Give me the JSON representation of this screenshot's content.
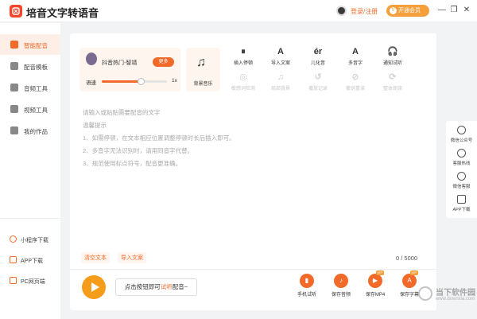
{
  "app": {
    "title": "培音文字转语音"
  },
  "header": {
    "login_label": "登录/注册",
    "vip_label": "开通会员",
    "vip_badge": "V",
    "minimize": "—",
    "maximize": "❐",
    "close": "✕"
  },
  "sidebar": {
    "items": [
      {
        "label": "智能配音",
        "active": true
      },
      {
        "label": "配音模板"
      },
      {
        "label": "音频工具"
      },
      {
        "label": "视频工具"
      },
      {
        "label": "我的作品"
      }
    ],
    "bottom_links": [
      {
        "label": "小程序下载"
      },
      {
        "label": "APP下载"
      },
      {
        "label": "PC网页端"
      }
    ]
  },
  "voice": {
    "name": "抖音热门-智靖",
    "more_label": "更多",
    "speed_label": "语速",
    "speed_value": "1x",
    "speed_fraction": 0.6
  },
  "bgm": {
    "label": "背景音乐",
    "icon": "music-note-icon"
  },
  "tools_row1": [
    {
      "label": "插入停顿",
      "icon": "pause-icon",
      "glyph": "⏸"
    },
    {
      "label": "导入文案",
      "icon": "import-icon",
      "glyph": "A"
    },
    {
      "label": "儿化音",
      "icon": "er-icon",
      "glyph": "ér"
    },
    {
      "label": "多音字",
      "icon": "polyphone-icon",
      "glyph": "A"
    },
    {
      "label": "通知试听",
      "icon": "headphones-icon",
      "glyph": "🎧"
    }
  ],
  "tools_row2": [
    {
      "label": "敏感词检测",
      "icon": "check-icon",
      "glyph": "◎"
    },
    {
      "label": "局部背景",
      "icon": "music-icon",
      "glyph": "♫"
    },
    {
      "label": "播放记录",
      "icon": "history-icon",
      "glyph": "↺"
    },
    {
      "label": "撤销重读",
      "icon": "undo-icon",
      "glyph": "⊘"
    },
    {
      "label": "整体朗读",
      "icon": "loop-icon",
      "glyph": "⟳"
    }
  ],
  "editor": {
    "placeholder": "请输入或粘贴需要配音的文字",
    "tip_title": "温馨提示",
    "tips": [
      "1、如需停顿，在文本相应位置调整停顿时长后插入即可。",
      "2、多音字无法识别时，请用同音字代替。",
      "3、规范使用标点符号，配音更准确。"
    ],
    "clear_label": "清空文本",
    "import_label": "导入文案",
    "char_count": "0 / 5000"
  },
  "bottom": {
    "hint_prefix": "点击按钮即可",
    "hint_highlight": "试听",
    "hint_suffix": "配音~",
    "actions": [
      {
        "label": "手机试听",
        "glyph": "▮"
      },
      {
        "label": "保存音频",
        "glyph": "♪"
      },
      {
        "label": "保存MP4",
        "glyph": "▶",
        "tag": "VIP"
      },
      {
        "label": "保存字幕",
        "glyph": "A",
        "tag": "VIP"
      }
    ]
  },
  "right_rail": [
    {
      "label": "微信公众号"
    },
    {
      "label": "客服热线"
    },
    {
      "label": "微信客服"
    },
    {
      "label": "APP下载"
    }
  ],
  "watermark": {
    "text": "当下软件园",
    "url": "www.downxia.com"
  }
}
